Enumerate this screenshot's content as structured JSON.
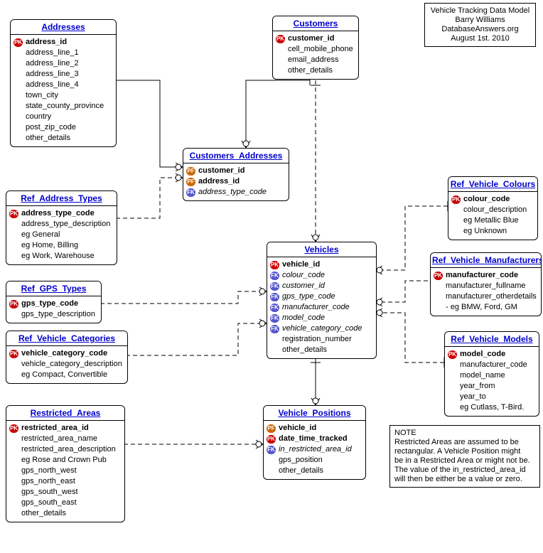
{
  "meta": {
    "title": "Vehicle Tracking Data Model",
    "author": "Barry Williams",
    "site": "DatabaseAnswers.org",
    "date": "August 1st. 2010"
  },
  "note": {
    "heading": "NOTE",
    "text1": "Restricted Areas are assumed to be",
    "text2": "rectangular. A Vehicle Position might",
    "text3": "be in a Restricted Area or might not be.",
    "text4": "The value of the in_restricted_area_id",
    "text5": "will then be either be a value or zero."
  },
  "badges": {
    "pk": "PK",
    "fk": "FK",
    "pf": "PF"
  },
  "entities": {
    "addresses": {
      "title": "Addresses",
      "attrs": [
        {
          "key": "pk",
          "name": "address_id"
        },
        {
          "key": "",
          "name": "address_line_1"
        },
        {
          "key": "",
          "name": "address_line_2"
        },
        {
          "key": "",
          "name": "address_line_3"
        },
        {
          "key": "",
          "name": "address_line_4"
        },
        {
          "key": "",
          "name": "town_city"
        },
        {
          "key": "",
          "name": "state_county_province"
        },
        {
          "key": "",
          "name": "country"
        },
        {
          "key": "",
          "name": "post_zip_code"
        },
        {
          "key": "",
          "name": "other_details"
        }
      ]
    },
    "customers": {
      "title": "Customers",
      "attrs": [
        {
          "key": "pk",
          "name": "customer_id"
        },
        {
          "key": "",
          "name": "cell_mobile_phone"
        },
        {
          "key": "",
          "name": "email_address"
        },
        {
          "key": "",
          "name": "other_details"
        }
      ]
    },
    "customers_addresses": {
      "title": "Customers_Addresses",
      "attrs": [
        {
          "key": "pf",
          "name": "customer_id"
        },
        {
          "key": "pf",
          "name": "address_id"
        },
        {
          "key": "fk",
          "name": "address_type_code"
        }
      ]
    },
    "ref_address_types": {
      "title": "Ref_Address_Types",
      "attrs": [
        {
          "key": "pk",
          "name": "address_type_code"
        },
        {
          "key": "",
          "name": "address_type_description"
        },
        {
          "key": "",
          "name": "eg General"
        },
        {
          "key": "",
          "name": "eg Home, Billing"
        },
        {
          "key": "",
          "name": "eg Work, Warehouse"
        }
      ]
    },
    "ref_gps_types": {
      "title": "Ref_GPS_Types",
      "attrs": [
        {
          "key": "pk",
          "name": "gps_type_code"
        },
        {
          "key": "",
          "name": "gps_type_description"
        }
      ]
    },
    "ref_vehicle_categories": {
      "title": "Ref_Vehicle_Categories",
      "attrs": [
        {
          "key": "pk",
          "name": "vehicle_category_code"
        },
        {
          "key": "",
          "name": "vehicle_category_description"
        },
        {
          "key": "",
          "name": "eg Compact, Convertible"
        }
      ]
    },
    "restricted_areas": {
      "title": "Restricted_Areas",
      "attrs": [
        {
          "key": "pk",
          "name": "restricted_area_id"
        },
        {
          "key": "",
          "name": "restricted_area_name"
        },
        {
          "key": "",
          "name": "restricted_area_description"
        },
        {
          "key": "",
          "name": "eg Rose and Crown Pub"
        },
        {
          "key": "",
          "name": "gps_north_west"
        },
        {
          "key": "",
          "name": "gps_north_east"
        },
        {
          "key": "",
          "name": "gps_south_west"
        },
        {
          "key": "",
          "name": "gps_south_east"
        },
        {
          "key": "",
          "name": "other_details"
        }
      ]
    },
    "vehicles": {
      "title": "Vehicles",
      "attrs": [
        {
          "key": "pk",
          "name": "vehicle_id"
        },
        {
          "key": "fk",
          "name": "colour_code"
        },
        {
          "key": "fk",
          "name": "customer_id"
        },
        {
          "key": "fk",
          "name": "gps_type_code"
        },
        {
          "key": "fk",
          "name": "manufacturer_code"
        },
        {
          "key": "fk",
          "name": "model_code"
        },
        {
          "key": "fk",
          "name": "vehicle_category_code"
        },
        {
          "key": "",
          "name": "registration_number"
        },
        {
          "key": "",
          "name": "other_details"
        }
      ]
    },
    "vehicle_positions": {
      "title": "Vehicle_Positions",
      "attrs": [
        {
          "key": "pf",
          "name": "vehicle_id"
        },
        {
          "key": "pk",
          "name": "date_time_tracked"
        },
        {
          "key": "fk",
          "name": "in_restricted_area_id"
        },
        {
          "key": "",
          "name": "gps_position"
        },
        {
          "key": "",
          "name": "other_details"
        }
      ]
    },
    "ref_vehicle_colours": {
      "title": "Ref_Vehicle_Colours",
      "attrs": [
        {
          "key": "pk",
          "name": "colour_code"
        },
        {
          "key": "",
          "name": "colour_description"
        },
        {
          "key": "",
          "name": "eg Metallic Blue"
        },
        {
          "key": "",
          "name": "eg Unknown"
        }
      ]
    },
    "ref_vehicle_manufacturers": {
      "title": "Ref_Vehicle_Manufacturers",
      "attrs": [
        {
          "key": "pk",
          "name": "manufacturer_code"
        },
        {
          "key": "",
          "name": "manufacturer_fullname"
        },
        {
          "key": "",
          "name": "manufacturer_otherdetails"
        },
        {
          "key": "",
          "name": "- eg BMW, Ford, GM"
        }
      ]
    },
    "ref_vehicle_models": {
      "title": "Ref_Vehicle_Models",
      "attrs": [
        {
          "key": "pk",
          "name": "model_code"
        },
        {
          "key": "",
          "name": "manufacturer_code"
        },
        {
          "key": "",
          "name": "model_name"
        },
        {
          "key": "",
          "name": "year_from"
        },
        {
          "key": "",
          "name": "year_to"
        },
        {
          "key": "",
          "name": "eg Cutlass, T-Bird."
        }
      ]
    }
  }
}
